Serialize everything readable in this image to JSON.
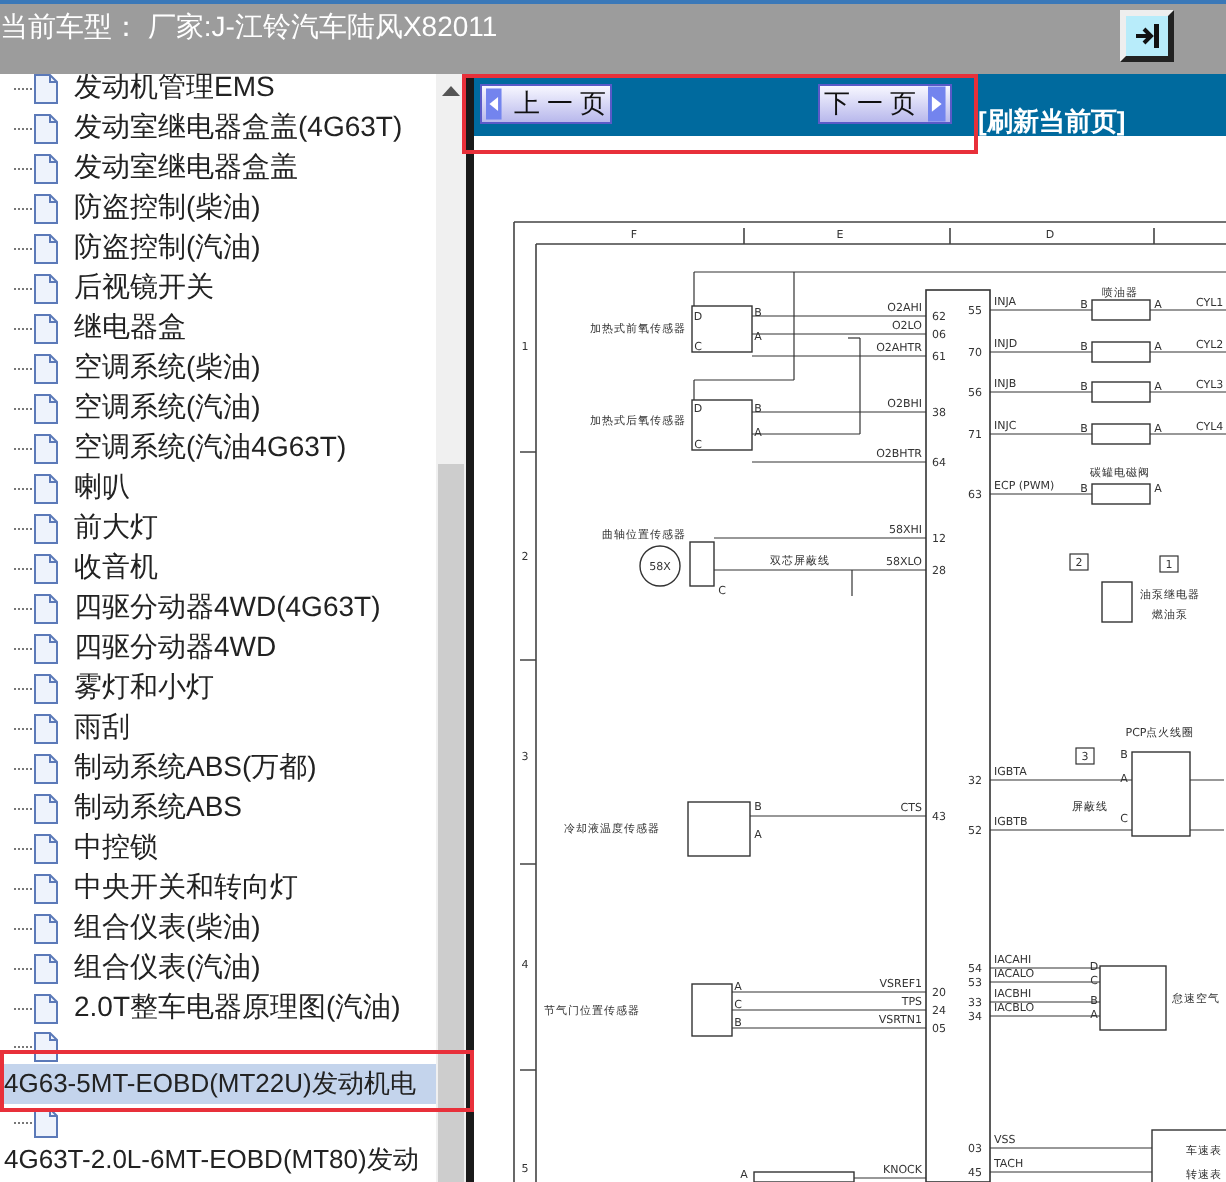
{
  "header": {
    "title": "当前车型： 厂家:J-江铃汽车陆风X82011"
  },
  "tree": [
    {
      "label": "发动机管理EMS",
      "kind": "inline",
      "selected": false
    },
    {
      "label": "发动室继电器盒盖(4G63T)",
      "kind": "inline",
      "selected": false
    },
    {
      "label": "发动室继电器盒盖",
      "kind": "inline",
      "selected": false
    },
    {
      "label": "防盗控制(柴油)",
      "kind": "inline",
      "selected": false
    },
    {
      "label": "防盗控制(汽油)",
      "kind": "inline",
      "selected": false
    },
    {
      "label": "后视镜开关",
      "kind": "inline",
      "selected": false
    },
    {
      "label": "继电器盒",
      "kind": "inline",
      "selected": false
    },
    {
      "label": "空调系统(柴油)",
      "kind": "inline",
      "selected": false
    },
    {
      "label": "空调系统(汽油)",
      "kind": "inline",
      "selected": false
    },
    {
      "label": "空调系统(汽油4G63T)",
      "kind": "inline",
      "selected": false
    },
    {
      "label": "喇叭",
      "kind": "inline",
      "selected": false
    },
    {
      "label": "前大灯",
      "kind": "inline",
      "selected": false
    },
    {
      "label": "收音机",
      "kind": "inline",
      "selected": false
    },
    {
      "label": "四驱分动器4WD(4G63T)",
      "kind": "inline",
      "selected": false
    },
    {
      "label": "四驱分动器4WD",
      "kind": "inline",
      "selected": false
    },
    {
      "label": "雾灯和小灯",
      "kind": "inline",
      "selected": false
    },
    {
      "label": "雨刮",
      "kind": "inline",
      "selected": false
    },
    {
      "label": "制动系统ABS(万都)",
      "kind": "inline",
      "selected": false
    },
    {
      "label": "制动系统ABS",
      "kind": "inline",
      "selected": false
    },
    {
      "label": "中控锁",
      "kind": "inline",
      "selected": false
    },
    {
      "label": "中央开关和转向灯",
      "kind": "inline",
      "selected": false
    },
    {
      "label": "组合仪表(柴油)",
      "kind": "inline",
      "selected": false
    },
    {
      "label": "组合仪表(汽油)",
      "kind": "inline",
      "selected": false
    },
    {
      "label": "2.0T整车电器原理图(汽油)",
      "kind": "inline",
      "selected": false
    },
    {
      "label": "4G63-5MT-EOBD(MT22U)发动机电",
      "kind": "wrapped",
      "selected": true
    },
    {
      "label": "4G63T-2.0L-6MT-EOBD(MT80)发动",
      "kind": "wrapped",
      "selected": false
    }
  ],
  "nav": {
    "prev_button": "上 一 页",
    "next_button": "下 一 页",
    "refresh_link": "[刷新当前页]"
  },
  "diagram": {
    "column_labels": [
      "F",
      "E",
      "D"
    ],
    "row_labels": [
      "1",
      "2",
      "3",
      "4",
      "5"
    ],
    "left_components": [
      {
        "label": "加热式前氧传感器",
        "terminals": [
          "D",
          "B",
          "A",
          "C"
        ],
        "pins": [
          {
            "signal": "O2AHI",
            "number": "62"
          },
          {
            "signal": "O2LO",
            "number": "06"
          },
          {
            "signal": "O2AHTR",
            "number": "61"
          }
        ]
      },
      {
        "label": "加热式后氧传感器",
        "terminals": [
          "D",
          "B",
          "A",
          "C"
        ],
        "pins": [
          {
            "signal": "O2BHI",
            "number": "38"
          },
          {
            "signal": "O2BHTR",
            "number": "64"
          }
        ]
      },
      {
        "label": "曲轴位置传感器",
        "terminals": [
          "C"
        ],
        "extras": [
          "58X",
          "双芯屏蔽线"
        ],
        "pins": [
          {
            "signal": "58XHI",
            "number": "12"
          },
          {
            "signal": "58XLO",
            "number": "28"
          }
        ]
      },
      {
        "label": "冷却液温度传感器",
        "terminals": [
          "B",
          "A"
        ],
        "pins": [
          {
            "signal": "CTS",
            "number": "43"
          }
        ]
      },
      {
        "label": "节气门位置传感器",
        "terminals": [
          "A",
          "C",
          "B"
        ],
        "pins": [
          {
            "signal": "VSREF1",
            "number": "20"
          },
          {
            "signal": "TPS",
            "number": "24"
          },
          {
            "signal": "VSRTN1",
            "number": "05"
          }
        ]
      },
      {
        "terminals": [
          "A"
        ],
        "pins": [
          {
            "signal": "KNOCK"
          }
        ]
      }
    ],
    "right_components": [
      {
        "label": "喷油器",
        "terminals": [
          "B",
          "A",
          "B",
          "A",
          "B",
          "A",
          "B",
          "A"
        ],
        "pins": [
          {
            "signal": "INJA",
            "number": "55",
            "output": "CYL1"
          },
          {
            "signal": "INJD",
            "number": "70",
            "output": "CYL2"
          },
          {
            "signal": "INJB",
            "number": "56",
            "output": "CYL3"
          },
          {
            "signal": "INJC",
            "number": "71",
            "output": "CYL4"
          }
        ]
      },
      {
        "label": "碳罐电磁阀",
        "terminals": [
          "B",
          "A"
        ],
        "pins": [
          {
            "signal": "ECP (PWM)",
            "number": "63"
          }
        ]
      },
      {
        "label": "油泵继电器",
        "tags": [
          "2",
          "1"
        ],
        "extras": [
          "燃油泵"
        ]
      },
      {
        "label": "PCP点火线圈",
        "tags": [
          "3"
        ],
        "terminals": [
          "B",
          "A",
          "C"
        ],
        "extras": [
          "屏蔽线"
        ],
        "pins": [
          {
            "signal": "IGBTA",
            "number": "32"
          },
          {
            "signal": "IGBTB",
            "number": "52"
          }
        ]
      },
      {
        "label": "怠速空气",
        "terminals": [
          "D",
          "C",
          "B",
          "A"
        ],
        "pins": [
          {
            "signal": "IACAHI",
            "number": "54"
          },
          {
            "signal": "IACALO",
            "number": "53"
          },
          {
            "signal": "IACBHI",
            "number": "33"
          },
          {
            "signal": "IACBLO",
            "number": "34"
          }
        ]
      },
      {
        "extras": [
          "车速表",
          "转速表"
        ],
        "pins": [
          {
            "signal": "VSS",
            "number": "03"
          },
          {
            "signal": "TACH",
            "number": "45"
          }
        ]
      }
    ]
  }
}
